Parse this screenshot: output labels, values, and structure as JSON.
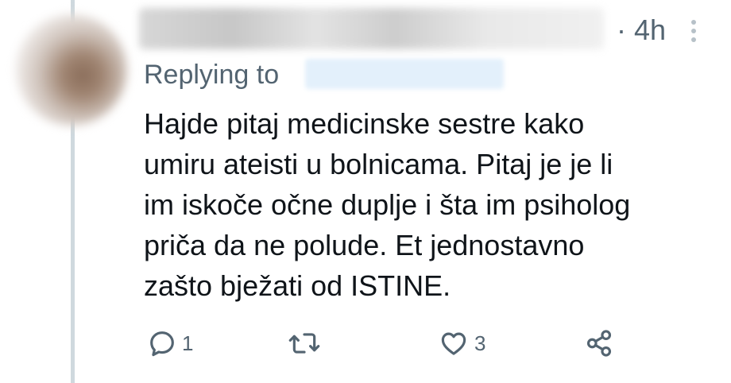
{
  "tweet": {
    "time": "· 4h",
    "replying_label": "Replying to",
    "text_lines": [
      "Hajde pitaj medicinske sestre kako",
      "umiru ateisti u bolnicama. Pitaj je je li",
      "im iskoče očne duplje i šta im psiholog",
      "priča da ne polude. Et jednostavno",
      "zašto bježati od ISTINE."
    ],
    "actions": {
      "reply_count": "1",
      "like_count": "3"
    }
  },
  "icons": {
    "more": "more-vertical-icon",
    "reply": "reply-icon",
    "retweet": "retweet-icon",
    "like": "heart-icon",
    "share": "share-icon"
  },
  "colors": {
    "text": "#0f1419",
    "secondary": "#536471",
    "thread_line": "#cfd9de"
  }
}
